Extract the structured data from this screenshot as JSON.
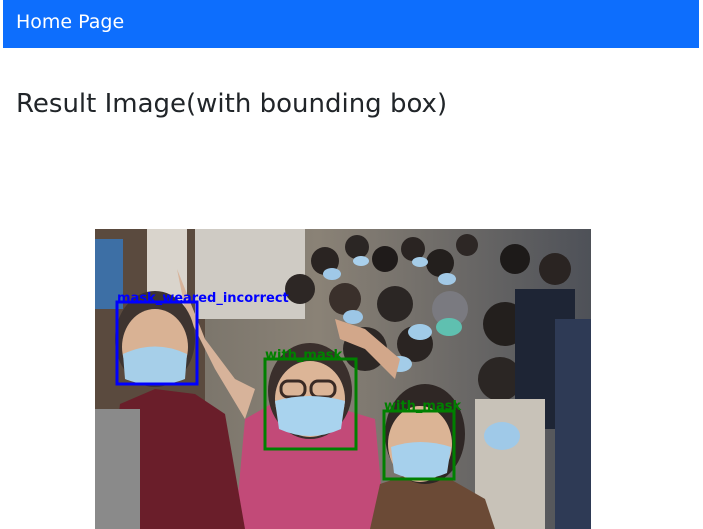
{
  "navbar": {
    "brand": "Home Page",
    "bg_color": "#0d6efd"
  },
  "page_title": "Result Image(with bounding box)",
  "detections": [
    {
      "label": "mask_weared_incorrect",
      "color": "#0000ff"
    },
    {
      "label": "with_mask",
      "color": "#008000"
    },
    {
      "label": "with_mask",
      "color": "#008000"
    }
  ]
}
